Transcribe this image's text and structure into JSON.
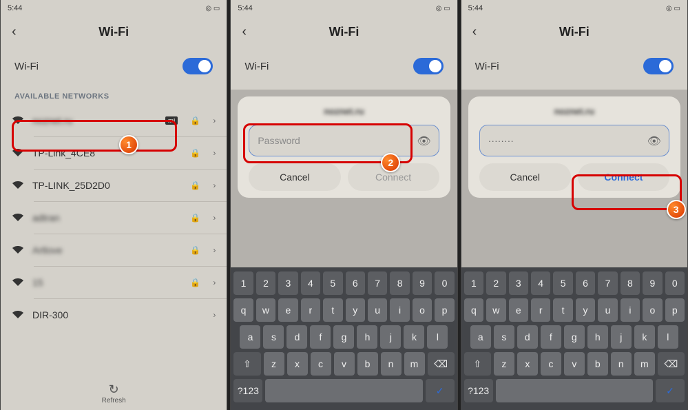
{
  "status": {
    "time": "5:44"
  },
  "header": {
    "title": "Wi-Fi"
  },
  "wifi": {
    "label": "Wi-Fi",
    "on": true
  },
  "section_label": "AVAILABLE NETWORKS",
  "networks": [
    {
      "name": "noznet.ru",
      "blurred": true,
      "mi": true
    },
    {
      "name": "TP-Link_4CE8",
      "blurred": false
    },
    {
      "name": "TP-LINK_25D2D0",
      "blurred": false
    },
    {
      "name": "adtran",
      "blurred": true
    },
    {
      "name": "Artlove",
      "blurred": true
    },
    {
      "name": "15",
      "blurred": true
    },
    {
      "name": "DIR-300",
      "blurred": false
    }
  ],
  "refresh_label": "Refresh",
  "dialog": {
    "network_name": "noznet.ru",
    "password_placeholder": "Password",
    "password_value": "········",
    "cancel": "Cancel",
    "connect": "Connect"
  },
  "keyboard": {
    "row_num": [
      "1",
      "2",
      "3",
      "4",
      "5",
      "6",
      "7",
      "8",
      "9",
      "0"
    ],
    "row1": [
      "q",
      "w",
      "e",
      "r",
      "t",
      "y",
      "u",
      "i",
      "o",
      "p"
    ],
    "row2": [
      "a",
      "s",
      "d",
      "f",
      "g",
      "h",
      "j",
      "k",
      "l"
    ],
    "row3": [
      "z",
      "x",
      "c",
      "v",
      "b",
      "n",
      "m"
    ],
    "symbols_key": "?123"
  },
  "annotations": {
    "step1": "1",
    "step2": "2",
    "step3": "3"
  }
}
